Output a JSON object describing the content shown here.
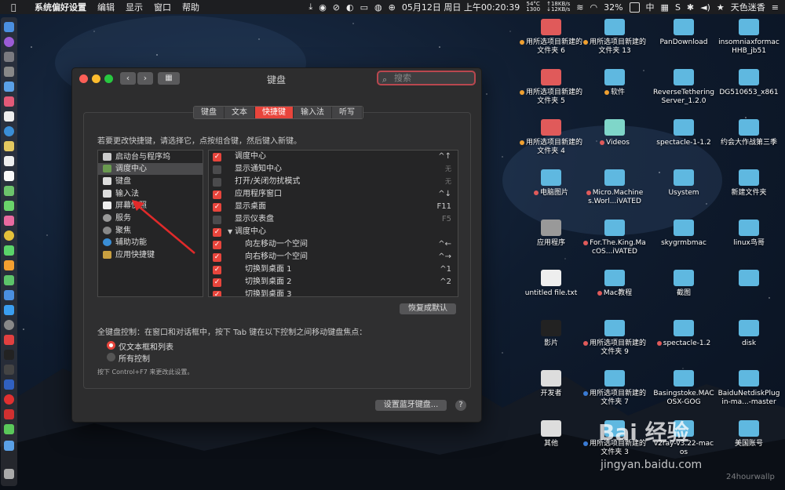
{
  "menubar": {
    "app": "系统偏好设置",
    "items": [
      "编辑",
      "显示",
      "窗口",
      "帮助"
    ],
    "cpu_temp": "54°C",
    "cpu_rpm": "1300",
    "net_up": "↑18KB/s",
    "net_down": "↓12KB/s",
    "datetime": "05月12日 周日 上午00:20:39",
    "battery": "32%",
    "input_method": "中",
    "user": "天色迷香"
  },
  "window": {
    "title": "系统偏好设置 - 键盘",
    "display_title": "键盘",
    "search_placeholder": "搜索",
    "tabs": [
      {
        "label": "键盘",
        "active": false
      },
      {
        "label": "文本",
        "active": false
      },
      {
        "label": "快捷键",
        "active": true
      },
      {
        "label": "输入法",
        "active": false
      },
      {
        "label": "听写",
        "active": false
      }
    ],
    "instruction": "若要更改快捷键，请选择它，点按组合键，然后键入新键。",
    "categories": [
      {
        "label": "启动台与程序坞",
        "icon": "launchpad-icon",
        "selected": false
      },
      {
        "label": "调度中心",
        "icon": "mission-control-icon",
        "selected": true
      },
      {
        "label": "键盘",
        "icon": "keyboard-icon",
        "selected": false
      },
      {
        "label": "输入法",
        "icon": "input-source-icon",
        "selected": false
      },
      {
        "label": "屏幕快照",
        "icon": "screenshot-icon",
        "selected": false
      },
      {
        "label": "服务",
        "icon": "gear-icon",
        "selected": false
      },
      {
        "label": "聚焦",
        "icon": "spotlight-icon",
        "selected": false
      },
      {
        "label": "辅助功能",
        "icon": "accessibility-icon",
        "selected": false
      },
      {
        "label": "应用快捷键",
        "icon": "app-shortcut-icon",
        "selected": false
      }
    ],
    "shortcuts": [
      {
        "label": "调度中心",
        "key": "^↑",
        "checked": true,
        "indent": false,
        "group": false
      },
      {
        "label": "显示通知中心",
        "key": "无",
        "checked": false,
        "indent": false,
        "group": false
      },
      {
        "label": "打开/关闭勿扰模式",
        "key": "无",
        "checked": false,
        "indent": false,
        "group": false
      },
      {
        "label": "应用程序窗口",
        "key": "^↓",
        "checked": true,
        "indent": false,
        "group": false
      },
      {
        "label": "显示桌面",
        "key": "F11",
        "checked": true,
        "indent": false,
        "group": false
      },
      {
        "label": "显示仪表盘",
        "key": "F5",
        "checked": false,
        "indent": false,
        "group": false
      },
      {
        "label": "调度中心",
        "key": "",
        "checked": true,
        "indent": false,
        "group": true
      },
      {
        "label": "向左移动一个空间",
        "key": "^←",
        "checked": true,
        "indent": true,
        "group": false
      },
      {
        "label": "向右移动一个空间",
        "key": "^→",
        "checked": true,
        "indent": true,
        "group": false
      },
      {
        "label": "切换到桌面 1",
        "key": "^1",
        "checked": true,
        "indent": true,
        "group": false
      },
      {
        "label": "切换到桌面 2",
        "key": "^2",
        "checked": true,
        "indent": true,
        "group": false
      },
      {
        "label": "切换到桌面 3",
        "key": "",
        "checked": true,
        "indent": true,
        "group": false
      }
    ],
    "restore_defaults": "恢复成默认",
    "full_keyboard_label": "全键盘控制：在窗口和对话框中，按下 Tab 键在以下控制之间移动键盘焦点：",
    "radio_options": [
      {
        "label": "仅文本框和列表",
        "selected": true
      },
      {
        "label": "所有控制",
        "selected": false
      }
    ],
    "hint": "按下 Control+F7 来更改此设置。",
    "bluetooth_button": "设置蓝牙键盘...",
    "help_button": "?"
  },
  "desktop_icons": [
    {
      "label": "用所选项目新建的文件夹 6",
      "color": "#e05a5a",
      "tag": "#f0a030"
    },
    {
      "label": "用所选项目新建的文件夹 13",
      "color": "#5fb8e0",
      "tag": "#f0a030"
    },
    {
      "label": "PanDownload",
      "color": "#5fb8e0",
      "tag": ""
    },
    {
      "label": "insomniaxformacHHB_jb51",
      "color": "#5fb8e0",
      "tag": ""
    },
    {
      "label": "用所选项目新建的文件夹 5",
      "color": "#e05a5a",
      "tag": "#f0a030"
    },
    {
      "label": "软件",
      "color": "#5fb8e0",
      "tag": "#f0a030"
    },
    {
      "label": "ReverseTetheringServer_1.2.0",
      "color": "#5fb8e0",
      "tag": ""
    },
    {
      "label": "DG510653_x861",
      "color": "#5fb8e0",
      "tag": ""
    },
    {
      "label": "用所选项目新建的文件夹 4",
      "color": "#e05a5a",
      "tag": "#f0a030"
    },
    {
      "label": "Videos",
      "color": "#7fd6c9",
      "tag": "#e05a5a"
    },
    {
      "label": "spectacle-1-1.2",
      "color": "#5fb8e0",
      "tag": ""
    },
    {
      "label": "约会大作战第三季",
      "color": "#5fb8e0",
      "tag": ""
    },
    {
      "label": "电脑图片",
      "color": "#5fb8e0",
      "tag": "#e05a5a"
    },
    {
      "label": "Micro.Machines.Worl...iVATED",
      "color": "#5fb8e0",
      "tag": "#e05a5a"
    },
    {
      "label": "Usystem",
      "color": "#5fb8e0",
      "tag": ""
    },
    {
      "label": "新建文件夹",
      "color": "#5fb8e0",
      "tag": ""
    },
    {
      "label": "应用程序",
      "color": "#999999",
      "tag": ""
    },
    {
      "label": "For.The.King.MacOS...iVATED",
      "color": "#5fb8e0",
      "tag": "#e05a5a"
    },
    {
      "label": "skygrmbmac",
      "color": "#5fb8e0",
      "tag": ""
    },
    {
      "label": "linux鸟哥",
      "color": "#5fb8e0",
      "tag": ""
    },
    {
      "label": "untitled file.txt",
      "color": "#eeeeee",
      "tag": ""
    },
    {
      "label": "Mac教程",
      "color": "#5fb8e0",
      "tag": "#e05a5a"
    },
    {
      "label": "截图",
      "color": "#5fb8e0",
      "tag": ""
    },
    {
      "label": "",
      "color": "#5fb8e0",
      "tag": ""
    },
    {
      "label": "影片",
      "color": "#222222",
      "tag": ""
    },
    {
      "label": "用所选项目新建的文件夹 9",
      "color": "#5fb8e0",
      "tag": "#e05a5a"
    },
    {
      "label": "spectacle-1.2",
      "color": "#5fb8e0",
      "tag": "#e05a5a"
    },
    {
      "label": "disk",
      "color": "#5fb8e0",
      "tag": ""
    },
    {
      "label": "开发者",
      "color": "#dddddd",
      "tag": ""
    },
    {
      "label": "用所选项目新建的文件夹 7",
      "color": "#5fb8e0",
      "tag": "#3a7bd5"
    },
    {
      "label": "Basingstoke.MACOSX-GOG",
      "color": "#5fb8e0",
      "tag": ""
    },
    {
      "label": "BaiduNetdiskPlugin-ma...-master",
      "color": "#5fb8e0",
      "tag": ""
    },
    {
      "label": "其他",
      "color": "#dddddd",
      "tag": ""
    },
    {
      "label": "用所选项目新建的文件夹 3",
      "color": "#5fb8e0",
      "tag": "#3a7bd5"
    },
    {
      "label": "v2ray-v3.22-macos",
      "color": "#5fb8e0",
      "tag": ""
    },
    {
      "label": "美国账号",
      "color": "#5fb8e0",
      "tag": ""
    }
  ],
  "watermark": {
    "brand": "Bai 经验",
    "url": "jingyan.baidu.com",
    "corner": "24hourwallp"
  },
  "colors": {
    "accent": "#e8453c",
    "folder": "#5fb8e0",
    "red_folder": "#e05a5a"
  }
}
